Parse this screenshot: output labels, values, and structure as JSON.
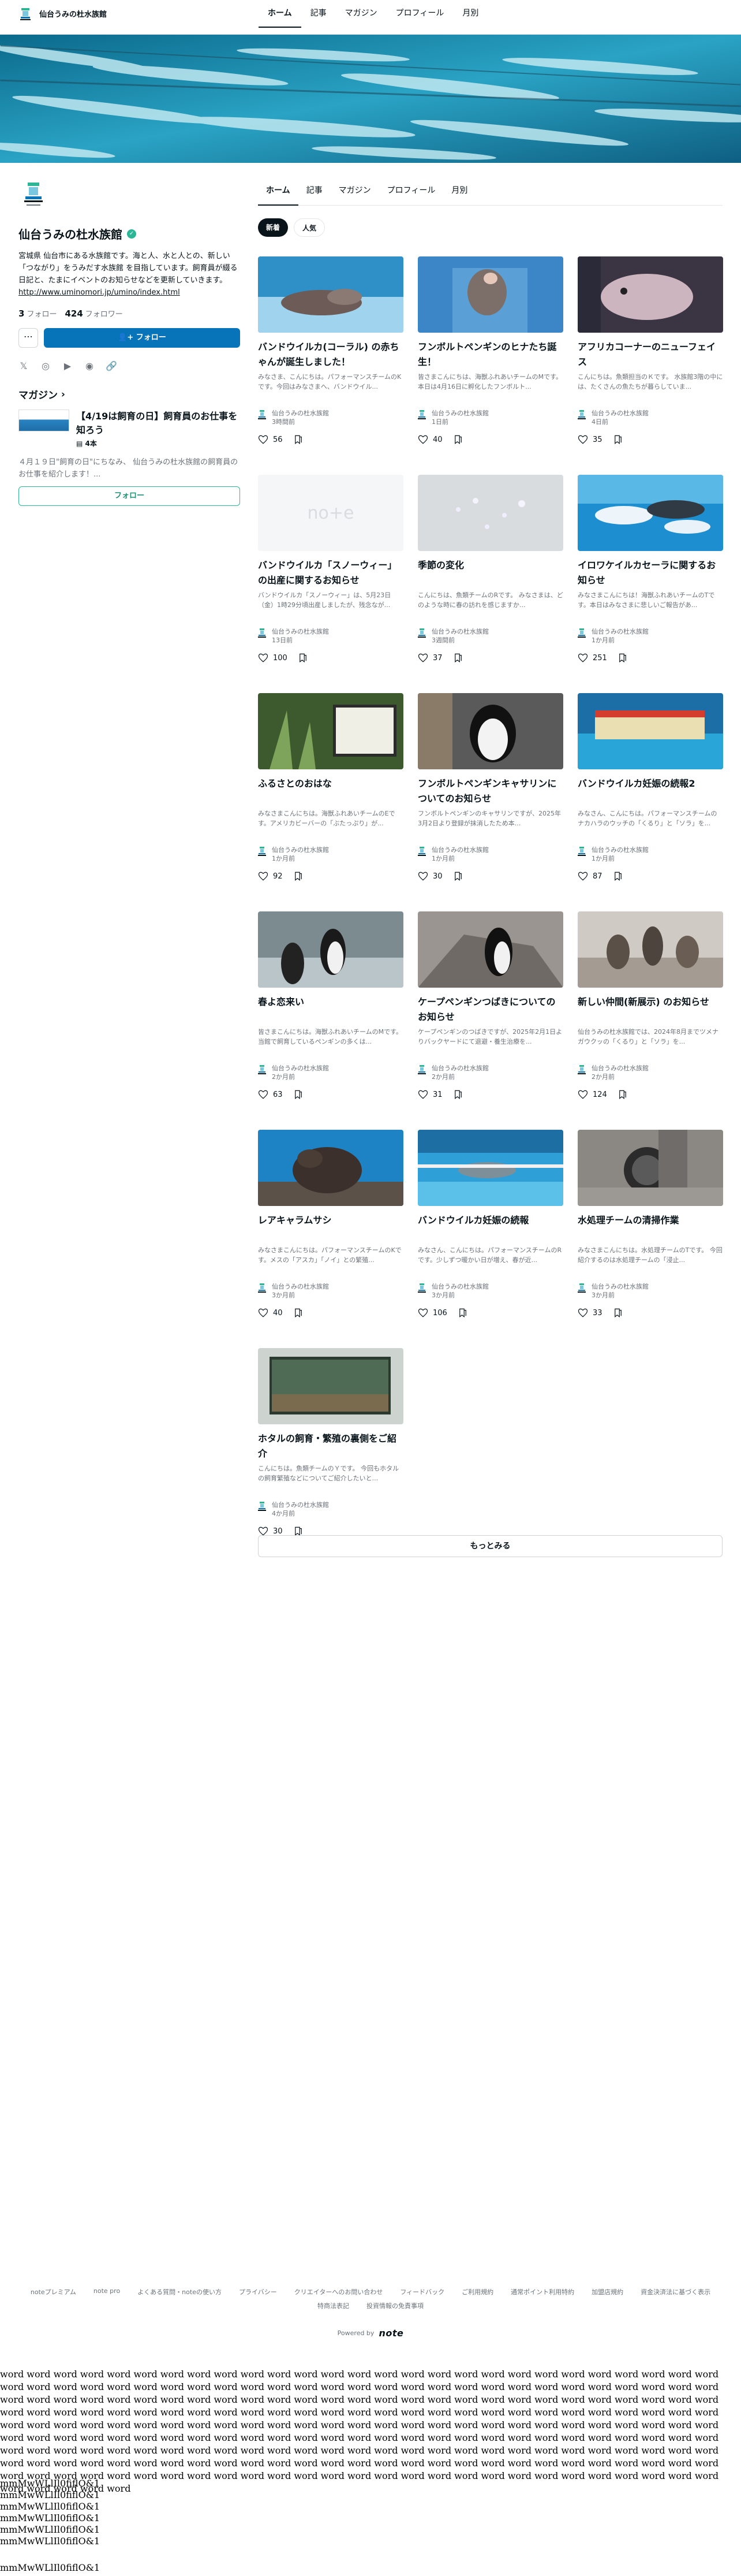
{
  "brand": "仙台うみの杜水族館",
  "top_nav": [
    "ホーム",
    "記事",
    "マガジン",
    "プロフィール",
    "月別"
  ],
  "profile": {
    "name": "仙台うみの杜水族館",
    "bio": "宮城県 仙台市にある水族館です。海と人、水と人との、新しい「つながり」をうみだす水族館 を目指しています。飼育員が綴る日記と、たまにイベントのお知らせなどを更新していきます。",
    "bio_link": "http://www.uminomori.jp/umino/index.html",
    "following_count": "3",
    "following_label": "フォロー",
    "followers_count": "424",
    "followers_label": "フォロワー",
    "more_label": "⋯",
    "follow_label": "フォロー"
  },
  "magazine": {
    "header": "マガジン",
    "title": "【4/19は飼育の日】飼育員のお仕事を知ろう",
    "count": "4本",
    "description": "４月１９日\"飼育の日\"にちなみ、 仙台うみの杜水族館の飼育員のお仕事を紹介します！...",
    "follow_label": "フォロー"
  },
  "main_tabs": [
    "ホーム",
    "記事",
    "マガジン",
    "プロフィール",
    "月別"
  ],
  "sort": [
    "新着",
    "人気"
  ],
  "articles": [
    {
      "title": "バンドウイルカ(コーラル) の赤ちゃんが誕生しました！",
      "excerpt": "みなさま、こんにちは。パフォーマンスチームのKです。今回はみなさまへ、バンドウイル...",
      "author": "仙台うみの杜水族館",
      "date": "3時間前",
      "likes": "56"
    },
    {
      "title": "フンボルトペンギンのヒナたち誕生！",
      "excerpt": "皆さまこんにちは、海獣ふれあいチームのMです。 本日は4月16日に孵化したフンボルト...",
      "author": "仙台うみの杜水族館",
      "date": "1日前",
      "likes": "40"
    },
    {
      "title": "アフリカコーナーのニューフェイス",
      "excerpt": "こんにちは。魚類担当のＫです。 水族館3階の中には、たくさんの魚たちが暮らしていま...",
      "author": "仙台うみの杜水族館",
      "date": "4日前",
      "likes": "35"
    },
    {
      "title": "バンドウイルカ「スノーウィー」の出産に関するお知らせ",
      "excerpt": "バンドウイルカ「スノーウィー」は、5月23日（金）1時29分頃出産しましたが、残念なが...",
      "author": "仙台うみの杜水族館",
      "date": "13日前",
      "likes": "100"
    },
    {
      "title": "季節の変化",
      "excerpt": "こんにちは、魚類チームのRです。 みなさまは、どのような時に春の訪れを感じますか...",
      "author": "仙台うみの杜水族館",
      "date": "3週間前",
      "likes": "37"
    },
    {
      "title": "イロワケイルカセーラに関するお知らせ",
      "excerpt": "みなさまこんにちは！海獣ふれあいチームのTです。本日はみなさまに悲しいご報告があ...",
      "author": "仙台うみの杜水族館",
      "date": "1か月前",
      "likes": "251"
    },
    {
      "title": "ふるさとのおはな",
      "excerpt": "みなさまこんにちは。海獣ふれあいチームのEです。アメリカビーバーの「ぶたっぷり」が...",
      "author": "仙台うみの杜水族館",
      "date": "1か月前",
      "likes": "92"
    },
    {
      "title": "フンボルトペンギンキャサリンについてのお知らせ",
      "excerpt": "フンボルトペンギンのキャサリンですが、2025年3月2日より登録が抹消したため本...",
      "author": "仙台うみの杜水族館",
      "date": "1か月前",
      "likes": "30"
    },
    {
      "title": "バンドウイルカ妊娠の続報2",
      "excerpt": "みなさん、こんにちは。パフォーマンスチームのナカハラのウッチの「くるり」と「ソラ」を...",
      "author": "仙台うみの杜水族館",
      "date": "1か月前",
      "likes": "87"
    },
    {
      "title": "春よ恋来い",
      "excerpt": "皆さまこんにちは。海獣ふれあいチームのMです。当館で飼育しているペンギンの多くは...",
      "author": "仙台うみの杜水族館",
      "date": "2か月前",
      "likes": "63"
    },
    {
      "title": "ケープペンギンつばきについてのお知らせ",
      "excerpt": "ケープペンギンのつばきですが、2025年2月1日よりバックヤードにて退避・養生治療を...",
      "author": "仙台うみの杜水族館",
      "date": "2か月前",
      "likes": "31"
    },
    {
      "title": "新しい仲間(新展示) のお知らせ",
      "excerpt": "仙台うみの杜水族館では、2024年8月までツメナガウクッの「くるり」と「ソラ」を...",
      "author": "仙台うみの杜水族館",
      "date": "2か月前",
      "likes": "124"
    },
    {
      "title": "レアキャラムサシ",
      "excerpt": "みなさまこんにちは。パフォーマンスチームのKです。メスの「アスカ」「ノイ」との繁殖...",
      "author": "仙台うみの杜水族館",
      "date": "3か月前",
      "likes": "40"
    },
    {
      "title": "バンドウイルカ妊娠の続報",
      "excerpt": "みなさん、こんにちは。パフォーマンスチームのRです。少しずつ暖かい日が増え、春が近...",
      "author": "仙台うみの杜水族館",
      "date": "3か月前",
      "likes": "106"
    },
    {
      "title": "水処理チームの清掃作業",
      "excerpt": "みなさまこんにちは。水処理チームのTです。 今回紹介するのは水処理チームの「浸止...",
      "author": "仙台うみの杜水族館",
      "date": "3か月前",
      "likes": "33"
    },
    {
      "title": "ホタルの飼育・繁殖の裏側をご紹介",
      "excerpt": "こんにちは。魚類チームのＹです。 今回もホタルの飼育繁殖などについてご紹介したいと...",
      "author": "仙台うみの杜水族館",
      "date": "4か月前",
      "likes": "30"
    }
  ],
  "more_all": "もっとみる",
  "footer_links": [
    "noteプレミアム",
    "note pro",
    "よくある質問・noteの使い方",
    "プライバシー",
    "クリエイターへのお問い合わせ",
    "フィードバック",
    "ご利用規約",
    "通常ポイント利用特約",
    "加盟店規約",
    "資金決済法に基づく表示",
    "特商法表記",
    "投資情報の免責事項"
  ],
  "powered_by": "Powered by",
  "powered_logo": "note",
  "filler_line": "word word word word word word word word word word word word word word word word word word word word word word word word word word word word word word word word word word word word word word word word word word word word word word word word word word word word word word word word word word word word word word word word word word word word word word word word word word word word word word word word word word word word word word word word word word word word word word word word word word word word word word word word word word word word word word word word word word word word word word word word word word word word word word word word word word word word word word word word word word word word word word word word word word word word word word word word word word word word word word word word word word word word word word word word word word word word word word word word word word word word word word word word word word word word word word word word word word word word word word word word word word word word word word word word word word word word word word word word word word word word word word word word word word word word word word word word word word word word word word word word word word word word word word word word",
  "mono_lines": [
    "mmMwWLlIl0fiflO&1",
    "mmMwWLlIl0fiflO&1",
    "mmMwWLlIl0fiflO&1",
    "mmMwWLlIl0fiflO&1",
    "mmMwWLlIl0fiflO&1",
    "mmMwWLlIl0fiflO&1"
  ],
  "mono_last": "mmMwWLlIl0fiflO&1"
}
